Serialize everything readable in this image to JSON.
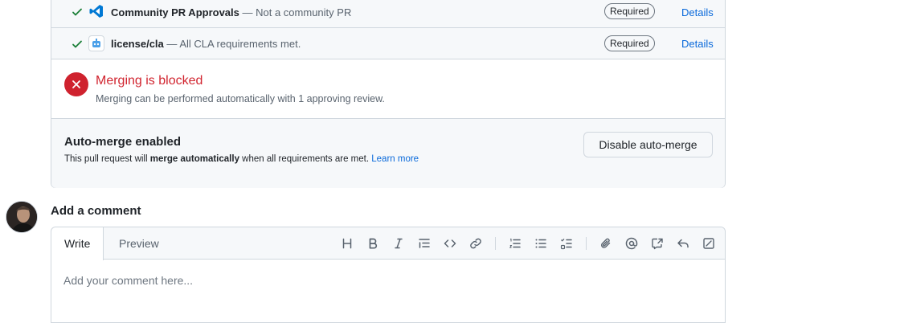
{
  "checks": [
    {
      "name": "Community PR Approvals",
      "separator": "—",
      "description": "Not a community PR",
      "badge": "Required",
      "link": "Details",
      "icon": "vscode-icon"
    },
    {
      "name": "license/cla",
      "separator": "—",
      "description": "All CLA requirements met.",
      "badge": "Required",
      "link": "Details",
      "icon": "cla-bot-icon"
    }
  ],
  "blocked": {
    "title": "Merging is blocked",
    "subtitle": "Merging can be performed automatically with 1 approving review."
  },
  "automerge": {
    "title": "Auto-merge enabled",
    "text_before": "This pull request will",
    "text_bold": "merge automatically",
    "text_after": "when all requirements are met.",
    "learn_more": "Learn more",
    "button": "Disable auto-merge"
  },
  "comment": {
    "heading": "Add a comment",
    "tabs": {
      "write": "Write",
      "preview": "Preview"
    },
    "placeholder": "Add your comment here..."
  },
  "colors": {
    "success": "#1a7f37",
    "danger": "#cf222e",
    "link": "#0969da"
  }
}
